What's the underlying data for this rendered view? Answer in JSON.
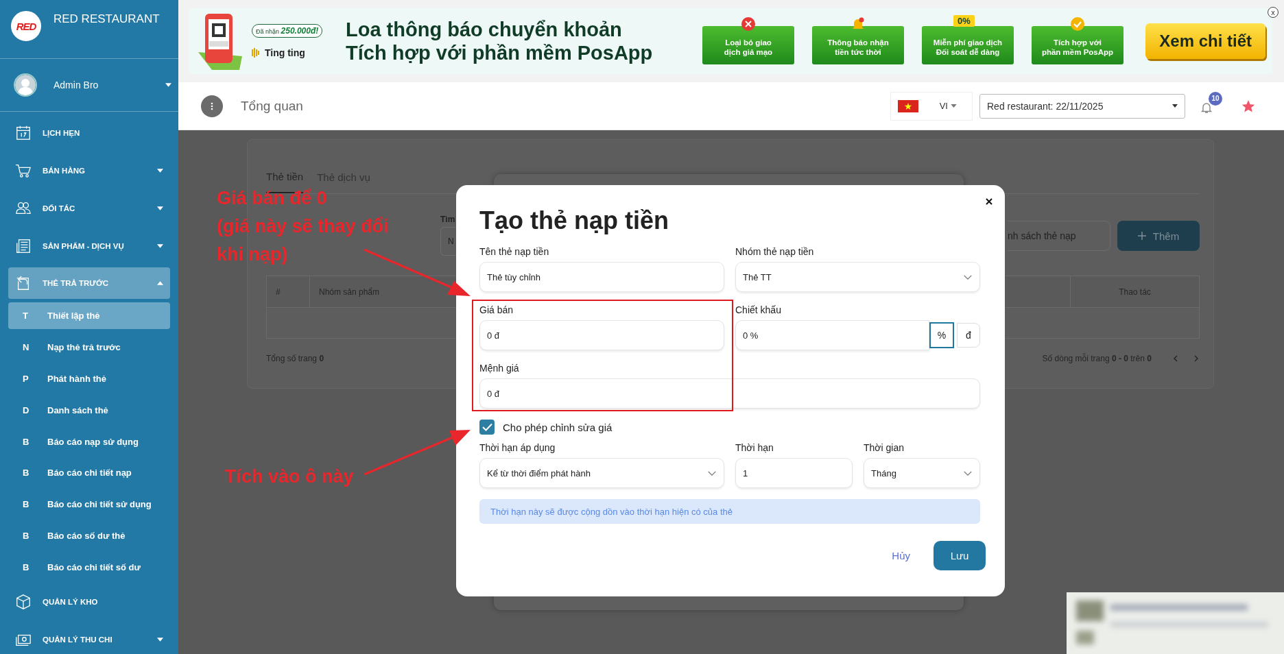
{
  "sidebar": {
    "logo_text": "RED",
    "brand": "RED RESTAURANT",
    "user": "Admin Bro",
    "items": [
      {
        "label": "LỊCH HẸN",
        "expandable": false,
        "selected": false
      },
      {
        "label": "BÁN HÀNG",
        "expandable": true,
        "expanded": false,
        "selected": false
      },
      {
        "label": "ĐỐI TÁC",
        "expandable": true,
        "expanded": false,
        "selected": false
      },
      {
        "label": "SẢN PHẨM - DỊCH VỤ",
        "expandable": true,
        "expanded": false,
        "selected": false
      },
      {
        "label": "THẺ TRẢ TRƯỚC",
        "expandable": true,
        "expanded": true,
        "selected": true,
        "children": [
          {
            "letter": "T",
            "label": "Thiết lập thẻ",
            "selected": true
          },
          {
            "letter": "N",
            "label": "Nạp thẻ trả trước",
            "selected": false
          },
          {
            "letter": "P",
            "label": "Phát hành thẻ",
            "selected": false
          },
          {
            "letter": "D",
            "label": "Danh sách thẻ",
            "selected": false
          },
          {
            "letter": "B",
            "label": "Báo cáo nạp sử dụng",
            "selected": false
          },
          {
            "letter": "B",
            "label": "Báo cáo chi tiết nạp",
            "selected": false
          },
          {
            "letter": "B",
            "label": "Báo cáo chi tiết sử dụng",
            "selected": false
          },
          {
            "letter": "B",
            "label": "Báo cáo số dư thẻ",
            "selected": false
          },
          {
            "letter": "B",
            "label": "Báo cáo chi tiết số dư",
            "selected": false
          }
        ]
      },
      {
        "label": "QUẢN LÝ KHO",
        "expandable": false,
        "selected": false
      },
      {
        "label": "QUẢN LÝ THU CHI",
        "expandable": true,
        "expanded": false,
        "selected": false
      }
    ]
  },
  "banner": {
    "badge": "Đã nhận **250.000đ!**",
    "brand": "Ting ting",
    "headline": [
      "Loa thông báo chuyển khoản",
      "Tích hợp với phần mềm PosApp"
    ],
    "features": [
      {
        "text": "Loại bỏ giao\ndịch giả mạo"
      },
      {
        "text": "Thông báo nhận\ntiền tức thời"
      },
      {
        "text": "Miễn phí giao dịch\nĐối soát dễ dàng",
        "tag": "0%"
      },
      {
        "text": "Tích hợp với\nphần mềm PosApp"
      }
    ],
    "cta": "Xem chi tiết",
    "close": "x"
  },
  "header": {
    "title": "Tổng quan",
    "language": "VI",
    "branch": "Red restaurant: 22/11/2025",
    "notifications": "10"
  },
  "page": {
    "tabs": [
      {
        "label": "Thẻ tiền",
        "selected": true
      },
      {
        "label": "Thẻ dịch vụ",
        "selected": false
      }
    ],
    "filters": [
      {
        "label": "Tìm",
        "placeholder": "N"
      }
    ],
    "list_button": "nh sách thẻ nạp",
    "add_button": "Thêm",
    "columns": [
      "#",
      "Nhóm sản phẩm",
      "Thao tác"
    ],
    "total": "Tổng số trang **0**",
    "paging": "Số dòng mỗi trang **0 - 0** trên **0**"
  },
  "modal": {
    "title": "Tạo thẻ nạp tiền",
    "rows": [
      [
        {
          "label": "Tên thẻ nạp tiền",
          "value": "Thẻ tùy chỉnh",
          "kind": "text"
        },
        {
          "label": "Nhóm thẻ nạp tiền",
          "value": "Thẻ TT",
          "kind": "select"
        }
      ],
      [
        {
          "label": "Giá bán",
          "value": "0 đ",
          "kind": "text"
        },
        {
          "label": "Chiết khấu",
          "value": "0 %",
          "kind": "unit",
          "units": [
            {
              "label": "%",
              "selected": true
            },
            {
              "label": "đ",
              "selected": false
            }
          ]
        }
      ],
      [
        {
          "label": "Mệnh giá",
          "value": "0 đ",
          "kind": "text"
        }
      ]
    ],
    "checkbox": {
      "label": "Cho phép chỉnh sửa giá",
      "checked": true
    },
    "term_row": [
      {
        "label": "Thời hạn áp dụng",
        "value": "Kể từ thời điểm phát hành",
        "kind": "select"
      },
      {
        "label": "Thời hạn",
        "value": "1",
        "kind": "text"
      },
      {
        "label": "Thời gian",
        "value": "Tháng",
        "kind": "select"
      }
    ],
    "note": "Thời hạn này sẽ được cộng dồn vào thời hạn hiện có của thẻ",
    "cancel": "Hủy",
    "save": "Lưu"
  },
  "annotations": [
    {
      "text": "Giá bán để 0\n(giá này sẽ thay đổi\nkhi nạp)"
    },
    {
      "text": "Tích vào ô này"
    }
  ]
}
